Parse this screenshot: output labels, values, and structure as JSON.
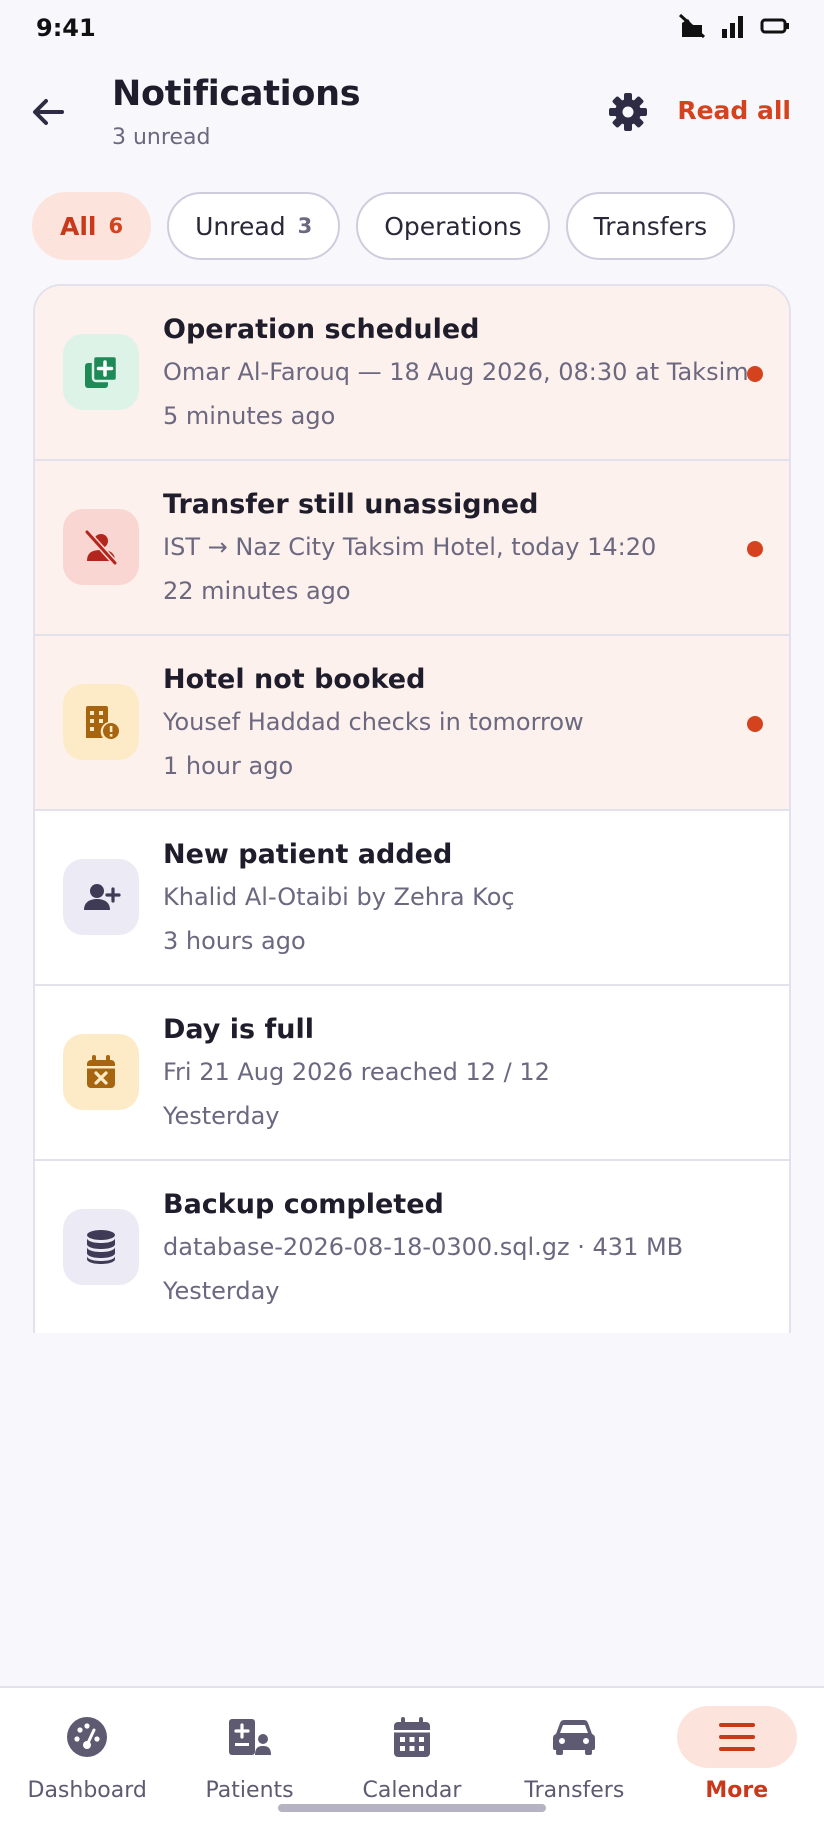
{
  "status_bar": {
    "time": "9:41"
  },
  "header": {
    "title": "Notifications",
    "subtitle": "3 unread",
    "read_all_label": "Read all"
  },
  "filters": [
    {
      "label": "All",
      "count": "6",
      "active": true
    },
    {
      "label": "Unread",
      "count": "3",
      "active": false
    },
    {
      "label": "Operations",
      "count": "",
      "active": false
    },
    {
      "label": "Transfers",
      "count": "",
      "active": false
    }
  ],
  "notifications": [
    {
      "title": "Operation scheduled",
      "description": "Omar Al-Farouq — 18 Aug 2026, 08:30 at Taksim",
      "time": "5 minutes ago",
      "unread": true,
      "icon": "add-operation-icon"
    },
    {
      "title": "Transfer still unassigned",
      "description": "IST → Naz City Taksim Hotel, today 14:20",
      "time": "22 minutes ago",
      "unread": true,
      "icon": "person-off-icon"
    },
    {
      "title": "Hotel not booked",
      "description": "Yousef Haddad checks in tomorrow",
      "time": "1 hour ago",
      "unread": true,
      "icon": "hotel-alert-icon"
    },
    {
      "title": "New patient added",
      "description": "Khalid Al-Otaibi by Zehra Koç",
      "time": "3 hours ago",
      "unread": false,
      "icon": "person-add-icon"
    },
    {
      "title": "Day is full",
      "description": "Fri 21 Aug 2026 reached 12 / 12",
      "time": "Yesterday",
      "unread": false,
      "icon": "calendar-x-icon"
    },
    {
      "title": "Backup completed",
      "description": "database-2026-08-18-0300.sql.gz · 431 MB",
      "time": "Yesterday",
      "unread": false,
      "icon": "database-icon"
    }
  ],
  "bottom_nav": [
    {
      "label": "Dashboard",
      "icon": "dashboard-icon",
      "active": false
    },
    {
      "label": "Patients",
      "icon": "patients-icon",
      "active": false
    },
    {
      "label": "Calendar",
      "icon": "calendar-icon",
      "active": false
    },
    {
      "label": "Transfers",
      "icon": "car-icon",
      "active": false
    },
    {
      "label": "More",
      "icon": "menu-icon",
      "active": true
    }
  ],
  "colors": {
    "accent": "#D4421E",
    "unread_background": "#FDF1EE",
    "active_chip": "#FCE4DC"
  }
}
